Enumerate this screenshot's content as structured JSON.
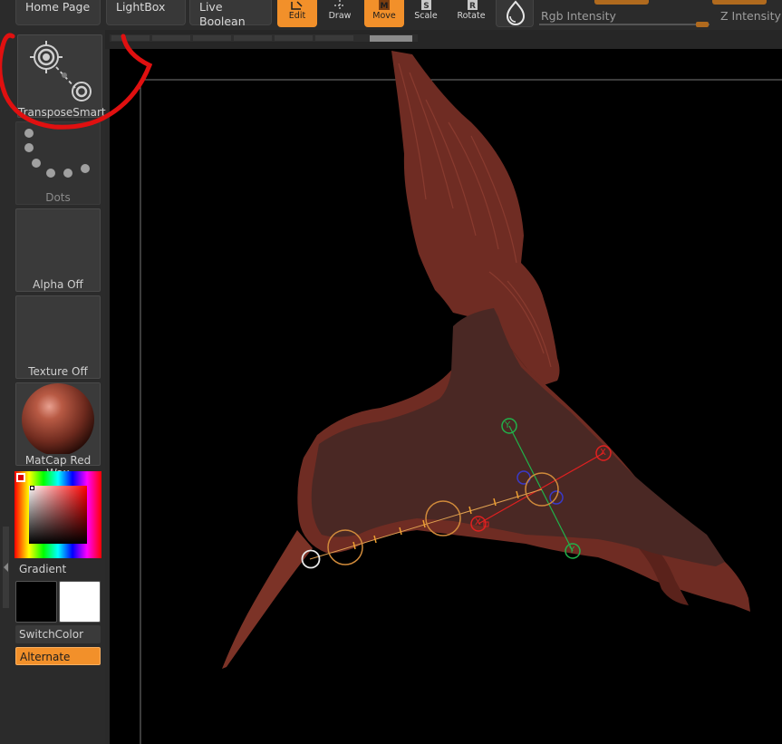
{
  "top_tabs": {
    "home": "Home Page",
    "lightbox": "LightBox",
    "live_boolean": "Live Boolean"
  },
  "tools": {
    "edit": "Edit",
    "draw": "Draw",
    "move": "Move",
    "scale": "Scale",
    "rotate": "Rotate"
  },
  "sliders": {
    "rgb_intensity": "Rgb Intensity",
    "z_intensity": "Z Intensity"
  },
  "tray": {
    "transpose_label": "TransposeSmart",
    "dots_label": "Dots",
    "alpha_label": "Alpha Off",
    "texture_label": "Texture Off",
    "material_label": "MatCap Red Wax",
    "gradient_label": "Gradient",
    "switchcolor_label": "SwitchColor",
    "alternate_label": "Alternate"
  },
  "gizmo": {
    "y_top": "Y",
    "y_bottom": "Y",
    "x_right": "X",
    "x_left": "X"
  },
  "colors": {
    "accent": "#f2902a",
    "annotation": "#e01010",
    "model": "#6b2a22",
    "cavity": "#4a2824",
    "main_color": "#000000",
    "secondary_color": "#ffffff"
  }
}
